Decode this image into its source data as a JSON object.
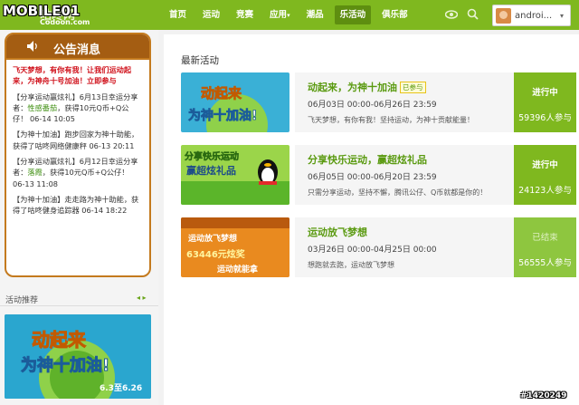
{
  "watermark": "MOBILE01",
  "logo": {
    "cn": "咕咚网",
    "en": "Codoon.com"
  },
  "nav": [
    {
      "label": "首页"
    },
    {
      "label": "运动"
    },
    {
      "label": "竞赛"
    },
    {
      "label": "应用",
      "caret": "▾"
    },
    {
      "label": "潮品"
    },
    {
      "label": "乐活动",
      "active": true
    },
    {
      "label": "俱乐部"
    }
  ],
  "user": {
    "name": "androi...",
    "caret": "▾"
  },
  "notice": {
    "title": "公告消息",
    "headline": "飞天梦想，有你有我！让我们运动起来，为神舟十号加油！立即参与",
    "items": [
      {
        "pre": "【分享运动赢炫礼】6月13日幸运分享者：",
        "name": "性感番茄",
        "post": "，获得10元Q币+Q公仔！ 06-14 10:05"
      },
      {
        "pre": "【为神十加油】跑步回家为神十助能，获得了咕咚网络健康秤 06-13 20:11",
        "name": "",
        "post": ""
      },
      {
        "pre": "【分享运动赢炫礼】6月12日幸运分享者：",
        "name": "落霞",
        "post": "，获得10元Q币+Q公仔！ 06-13 11:08"
      },
      {
        "pre": "【为神十加油】走走路为神十助能，获得了咕咚健身追踪器 06-14 18:22",
        "name": "",
        "post": ""
      }
    ]
  },
  "recommend": {
    "title": "活动推荐",
    "arrows": "◂ ▸"
  },
  "main": {
    "title": "最新活动",
    "activities": [
      {
        "name": "动起来，为神十加油",
        "tag": "已参与",
        "date": "06月03日 00:00-06月26日 23:59",
        "desc": "飞天梦想，有你有我！坚持运动，为神十贡献能量！",
        "status": "进行中",
        "count": "59396人参与",
        "thumb_text": "动起来 为神十加油!"
      },
      {
        "name": "分享快乐运动，赢超炫礼品",
        "tag": "",
        "date": "06月05日 00:00-06月20日 23:59",
        "desc": "只需分享运动，坚持不懈，腾讯公仔、Q币就都是你的！",
        "status": "进行中",
        "count": "24123人参与",
        "thumb_text": "分享快乐运动 赢超炫礼品"
      },
      {
        "name": "运动放飞梦想",
        "tag": "",
        "date": "03月26日 00:00-04月25日 00:00",
        "desc": "想跑就去跑，运动放飞梦想",
        "status": "已结束",
        "count": "56555人参与",
        "thumb_text": "运动放飞梦想 63446元炫奖 运动就能拿"
      }
    ]
  },
  "corner_tag": "#1420249",
  "colors": {
    "brand": "#7fb81f",
    "notice_border": "#c47a1e",
    "title_green": "#5a9a10"
  }
}
